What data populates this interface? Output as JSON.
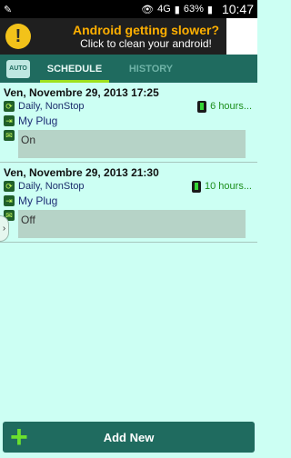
{
  "statusbar": {
    "network": "4G",
    "battery": "63%",
    "time": "10:47"
  },
  "ad": {
    "title": "Android getting slower?",
    "subtitle": "Click to clean your android!",
    "icon": "!"
  },
  "tabs": [
    {
      "label": "SCHEDULE",
      "active": true
    },
    {
      "label": "HISTORY",
      "active": false
    }
  ],
  "logo_text": "AUTO",
  "schedules": [
    {
      "date": "Ven, Novembre 29, 2013 17:25",
      "repeat": "Daily, NonStop",
      "time_left": "6 hours...",
      "device": "My Plug",
      "message": "On"
    },
    {
      "date": "Ven, Novembre 29, 2013 21:30",
      "repeat": "Daily, NonStop",
      "time_left": "10 hours...",
      "device": "My Plug",
      "message": "Off"
    }
  ],
  "add_new": {
    "label": "Add New",
    "icon": "+"
  },
  "side_handle": "›"
}
